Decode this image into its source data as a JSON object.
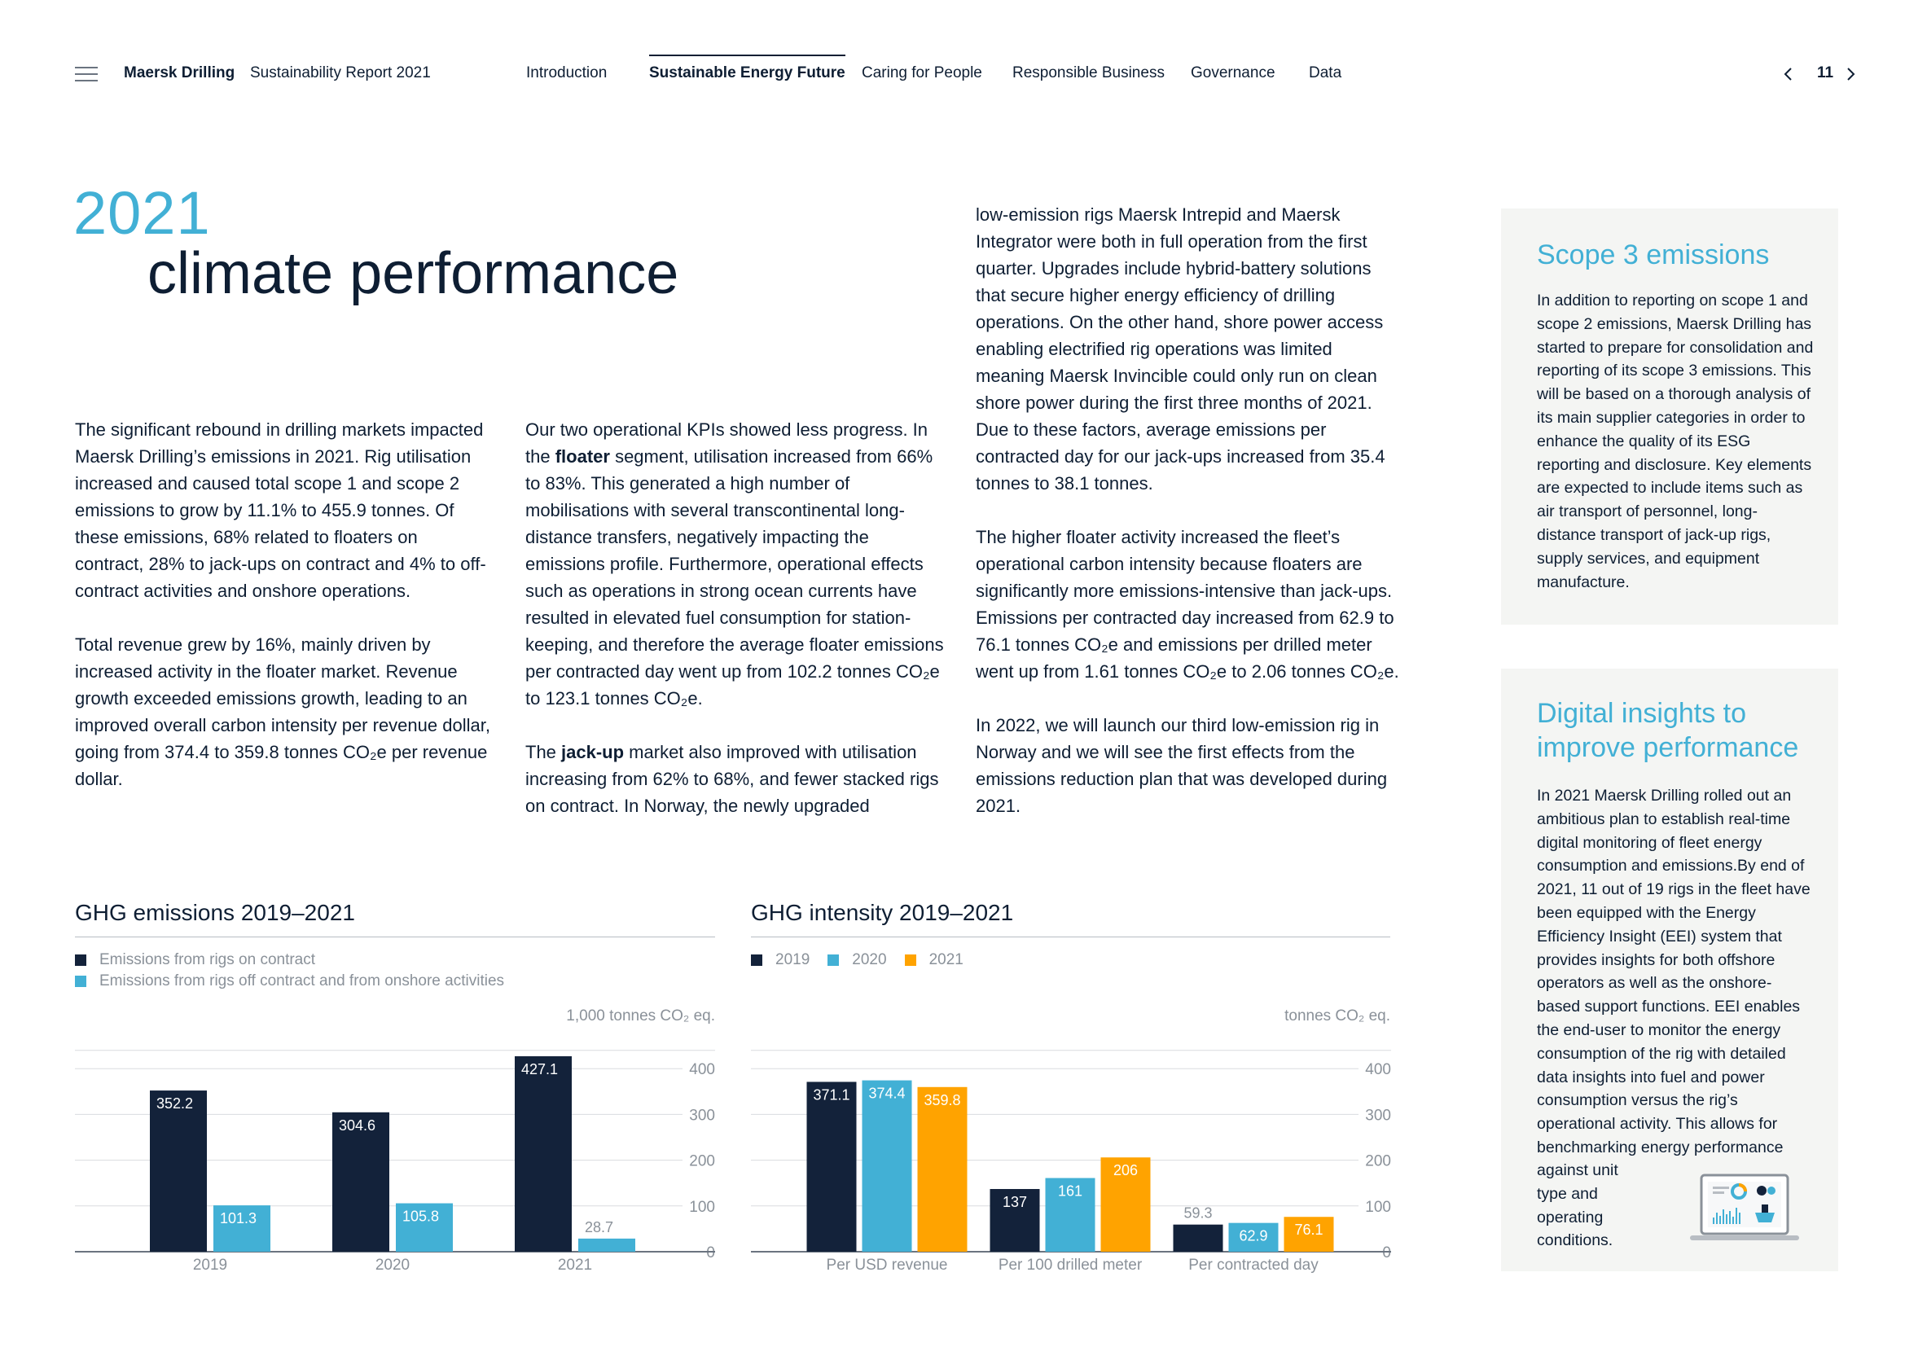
{
  "header": {
    "brand": "Maersk Drilling",
    "report": "Sustainability Report 2021",
    "nav": [
      "Introduction",
      "Sustainable Energy Future",
      "Caring for People",
      "Responsible Business",
      "Governance",
      "Data"
    ],
    "active_nav": "Sustainable Energy Future",
    "page_number": "11"
  },
  "headline": {
    "year": "2021",
    "title": "climate performance"
  },
  "col1": {
    "p1": "The significant rebound in drilling markets impacted Maersk Drilling’s emissions in 2021. Rig utilisation increased and caused total scope 1 and scope 2 emissions to grow by 11.1% to 455.9 tonnes. Of these emissions, 68% related to floaters on contract, 28% to jack-ups on contract and 4% to off-contract activities and onshore operations.",
    "p2": "Total revenue grew by 16%, mainly driven by increased activity in the floater market. Revenue growth exceeded emissions growth, leading to an improved overall carbon intensity per revenue dollar, going from 374.4 to 359.8 tonnes CO₂e per revenue dollar."
  },
  "col2": {
    "p1_a": "Our two operational KPIs showed less progress. In the ",
    "p1_bold": "floater",
    "p1_b": " segment, utilisation increased from 66% to 83%. This generated a high number of mobilisations with several transcontinental long-distance transfers, negatively impacting the emissions profile. Furthermore, operational effects such as operations in strong ocean currents have resulted in elevated fuel consumption for station-keeping, and therefore the average floater emissions per contracted day went up from 102.2 tonnes CO₂e to 123.1 tonnes CO₂e.",
    "p2_a": "The ",
    "p2_bold": "jack-up",
    "p2_b": " market also improved with utilisation increasing from 62% to 68%, and fewer stacked rigs on contract. In Norway, the newly upgraded"
  },
  "col3": {
    "p1": "low-emission rigs Maersk Intrepid and Maersk Integrator were both in full operation from the first quarter. Upgrades include hybrid-battery solutions that secure higher energy efficiency of drilling operations. On the other hand, shore power access enabling electrified rig operations was limited meaning Maersk Invincible could only run on clean shore power during the first three months of 2021. Due to these factors, average emissions per contracted day for our jack-ups increased from 35.4 tonnes to 38.1 tonnes.",
    "p2": "The higher floater activity increased the fleet’s operational carbon intensity because floaters are significantly more emissions-intensive than jack-ups. Emissions per contracted day increased from 62.9 to 76.1 tonnes CO₂e and emissions per drilled meter went up from 1.61 tonnes CO₂e to 2.06 tonnes CO₂e.",
    "p3": "In 2022, we will launch our third low-emission rig in Norway and we will see the first effects from the emissions reduction plan that was developed during 2021."
  },
  "sidebar": {
    "scope3_title": "Scope 3 emissions",
    "scope3_text": "In addition to reporting on scope 1 and scope 2 emissions, Maersk Drilling has started to prepare for consolidation and reporting of its scope 3 emissions. This will be based on a thorough analysis of its main supplier categories in order to enhance the quality of its ESG reporting and disclosure. Key elements are expected to include items such as air transport of personnel, long-distance transport of jack-up rigs, supply services, and equipment manufacture.",
    "digital_title": "Digital insights to improve performance",
    "digital_text_main": "In 2021 Maersk Drilling rolled out an ambitious plan to establish real-time digital monitoring of fleet energy consumption and emissions.By end of 2021, 11 out of 19 rigs in the fleet have been equipped with the Energy Efficiency Insight (EEI) system that provides insights for both offshore operators as well as the onshore-based support functions. EEI enables the end-user to monitor the energy consumption of the rig with detailed data insights into fuel and power consumption versus the rig’s operational activity. This allows for benchmarking energy performance",
    "digital_text_tail": "against unit type and operating conditions."
  },
  "colors": {
    "navy": "#13223a",
    "blue": "#42b0d5",
    "orange": "#ffa300",
    "grid": "#d9dcdf",
    "muted_text": "#8a9199"
  },
  "chart_data": [
    {
      "type": "bar",
      "title": "GHG emissions 2019–2021",
      "unit": "1,000 tonnes CO₂ eq.",
      "categories": [
        "2019",
        "2020",
        "2021"
      ],
      "series": [
        {
          "name": "Emissions from rigs on contract",
          "color": "#13223a",
          "values": [
            352.2,
            304.6,
            427.1
          ],
          "labels": [
            "352.2",
            "304.6",
            "427.1"
          ]
        },
        {
          "name": "Emissions from rigs off contract and from onshore activities",
          "color": "#42b0d5",
          "values": [
            101.3,
            105.8,
            28.7
          ],
          "labels": [
            "101.3",
            "105.8",
            "28.7"
          ]
        }
      ],
      "ylim": [
        0,
        400
      ],
      "yticks": [
        "0",
        "100",
        "200",
        "300",
        "400"
      ],
      "grid": true,
      "legend": "top-left"
    },
    {
      "type": "bar",
      "title": "GHG intensity 2019–2021",
      "unit": "tonnes CO₂ eq.",
      "categories": [
        "Per USD revenue",
        "Per 100 drilled meter",
        "Per contracted day"
      ],
      "series": [
        {
          "name": "2019",
          "color": "#13223a",
          "values": [
            371.1,
            137,
            59.3
          ],
          "labels": [
            "371.1",
            "137",
            "59.3"
          ]
        },
        {
          "name": "2020",
          "color": "#42b0d5",
          "values": [
            374.4,
            161,
            62.9
          ],
          "labels": [
            "374.4",
            "161",
            "62.9"
          ]
        },
        {
          "name": "2021",
          "color": "#ffa300",
          "values": [
            359.8,
            206,
            76.1
          ],
          "labels": [
            "359.8",
            "206",
            "76.1"
          ]
        }
      ],
      "ylim": [
        0,
        400
      ],
      "yticks": [
        "0",
        "100",
        "200",
        "300",
        "400"
      ],
      "grid": true,
      "legend": "top-left"
    }
  ]
}
